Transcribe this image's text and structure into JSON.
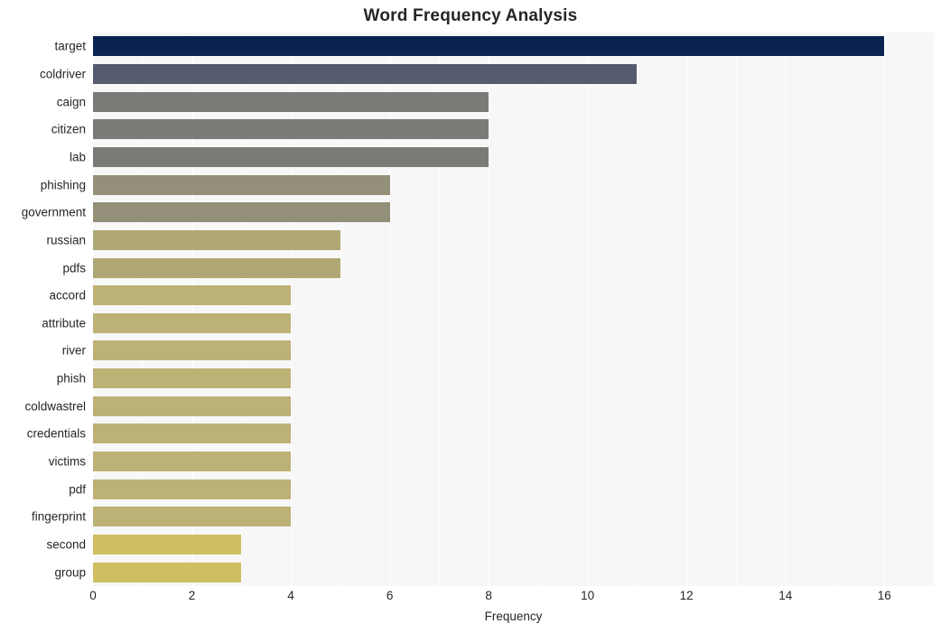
{
  "chart_data": {
    "type": "bar",
    "orientation": "horizontal",
    "title": "Word Frequency Analysis",
    "xlabel": "Frequency",
    "ylabel": "",
    "xlim": [
      0,
      17
    ],
    "xticks": [
      0,
      2,
      4,
      6,
      8,
      10,
      12,
      14,
      16
    ],
    "grid": true,
    "legend": null,
    "categories": [
      "target",
      "coldriver",
      "caign",
      "citizen",
      "lab",
      "phishing",
      "government",
      "russian",
      "pdfs",
      "accord",
      "attribute",
      "river",
      "phish",
      "coldwastrel",
      "credentials",
      "victims",
      "pdf",
      "fingerprint",
      "second",
      "group"
    ],
    "values": [
      16,
      11,
      8,
      8,
      8,
      6,
      6,
      5,
      5,
      4,
      4,
      4,
      4,
      4,
      4,
      4,
      4,
      4,
      3,
      3
    ],
    "bar_colors": [
      "#0a2351",
      "#555a६e",
      "#7b7a76",
      "#7b7a76",
      "#7b7a76",
      "#938f78",
      "#938f78",
      "#b0a874",
      "#b0a874",
      "#bcb276",
      "#bcb276",
      "#bcb276",
      "#bcb276",
      "#bcb276",
      "#bcb276",
      "#bcb276",
      "#bcb276",
      "#bcb276",
      "#cdbf62",
      "#cdbf62"
    ],
    "plot_background": "#f7f7f7",
    "figure_background": "#ffffff"
  },
  "colors": {
    "accent": "#0a2351",
    "text": "#262626",
    "plot_bg": "#f7f7f7"
  }
}
